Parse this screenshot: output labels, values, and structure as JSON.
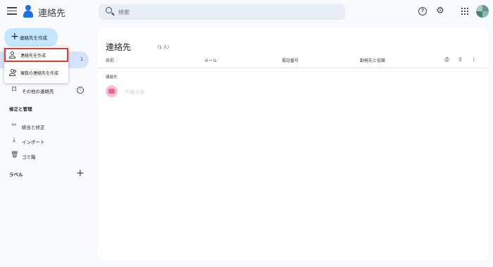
{
  "app": {
    "title": "連絡先"
  },
  "search": {
    "placeholder": "検索"
  },
  "header": {
    "icons": [
      "menu-icon",
      "help-icon",
      "settings-icon",
      "apps-icon",
      "account-avatar"
    ]
  },
  "create_button": {
    "label": "連絡先を作成"
  },
  "create_menu": {
    "items": [
      {
        "label": "連絡先を作成",
        "icon": "person-icon",
        "highlighted": true
      },
      {
        "label": "複数の連絡先を作成",
        "icon": "people-icon",
        "highlighted": false
      }
    ]
  },
  "sidebar": {
    "active_count": "1",
    "other_contacts": "その他の連絡先",
    "fix_manage_heading": "修正と管理",
    "items": [
      {
        "label": "統合と修正",
        "icon": "merge-fix-icon"
      },
      {
        "label": "インポート",
        "icon": "import-icon"
      },
      {
        "label": "ゴミ箱",
        "icon": "trash-icon"
      }
    ],
    "labels_heading": "ラベル"
  },
  "main": {
    "title": "連絡先",
    "count": "（1 人）",
    "columns": [
      "名前",
      "メール",
      "電話番号",
      "勤務先と役職"
    ],
    "toolbar_icons": [
      "print-icon",
      "export-icon",
      "more-vert-icon"
    ],
    "group_label": "連絡先",
    "rows": [
      {
        "name": "門脇太郎"
      }
    ]
  },
  "colors": {
    "accent": "#1a73e8",
    "create_button_bg": "#c2e7ff",
    "active_nav_bg": "#d3e3fd",
    "highlight_border": "#e53935"
  }
}
